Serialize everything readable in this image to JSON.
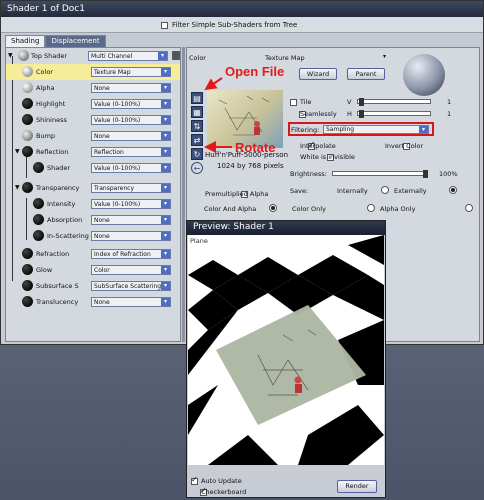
{
  "window": {
    "title": "Shader 1 of Doc1",
    "filter_label": "Filter Simple Sub-Shaders from Tree"
  },
  "tabs": [
    {
      "label": "Shading"
    },
    {
      "label": "Displacement"
    }
  ],
  "tree": {
    "rows": [
      {
        "label": "Top Shader",
        "value": "Multi Channel"
      },
      {
        "label": "Color",
        "value": "Texture Map"
      },
      {
        "label": "Alpha",
        "value": "None"
      },
      {
        "label": "Highlight",
        "value": "Value (0-100%)"
      },
      {
        "label": "Shininess",
        "value": "Value (0-100%)"
      },
      {
        "label": "Bump",
        "value": "None"
      },
      {
        "label": "Reflection",
        "value": "Reflection"
      },
      {
        "label": "Shader",
        "value": "Value (0-100%)"
      },
      {
        "label": "Transparency",
        "value": "Transparency"
      },
      {
        "label": "Intensity",
        "value": "Value (0-100%)"
      },
      {
        "label": "Absorption",
        "value": "None"
      },
      {
        "label": "In-Scattering",
        "value": "None"
      },
      {
        "label": "Refraction",
        "value": "Index of Refraction"
      },
      {
        "label": "Glow",
        "value": "Color"
      },
      {
        "label": "Subsurface S",
        "value": "SubSurface Scattering"
      },
      {
        "label": "Translucency",
        "value": "None"
      }
    ]
  },
  "right": {
    "color_label": "Color",
    "texture_map_label": "Texture Map",
    "wizard_label": "Wizard",
    "parent_label": "Parent",
    "tile_label": "Tile",
    "v_label": "V",
    "v_value": "1",
    "seamlessly_label": "Seamlessly",
    "h_label": "H",
    "h_value": "1",
    "filtering_label": "Filtering:",
    "filtering_value": "Sampling",
    "interpolate_label": "Interpolate",
    "invert_label": "Invert Color",
    "white_invisible_label": "White is invisible",
    "file_name": "Huff'n'Puff-5000-person",
    "dimensions": "1024 by 768 pixels",
    "brightness_label": "Brightness:",
    "brightness_value": "100%",
    "brightness_level": 1.0,
    "premult_label": "Premultiplied Alpha",
    "save_label": "Save:",
    "internally_label": "Internally",
    "externally_label": "Externally",
    "color_alpha_label": "Color And Alpha",
    "color_only_label": "Color Only",
    "alpha_only_label": "Alpha Only"
  },
  "annotations": {
    "open_file": "Open File",
    "rotate": "Rotate"
  },
  "preview": {
    "title": "Preview: Shader 1",
    "plane_label": "Plane",
    "auto_update_label": "Auto Update",
    "checkerboard_label": "Checkerboard",
    "render_label": "Render"
  },
  "colors": {
    "highlight_row": "#f6ed9a",
    "dropdown_arrow": "#4c6ec4",
    "annotation": "#e21a1a",
    "filtering_box": "#d61818"
  }
}
